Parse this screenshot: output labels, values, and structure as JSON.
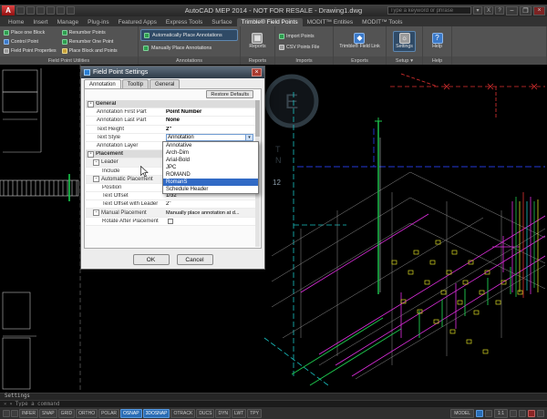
{
  "window": {
    "title": "AutoCAD MEP 2014 - NOT FOR RESALE - Drawing1.dwg",
    "search_placeholder": "Type a keyword or phrase",
    "logo_letter": "A",
    "controls": {
      "min": "–",
      "max": "❐",
      "close": "×"
    }
  },
  "ribbon": {
    "tabs": [
      "Home",
      "Insert",
      "Manage",
      "Plug-ins",
      "Featured Apps",
      "Express Tools",
      "Surface",
      "Trimble® Field Points",
      "MODIT™ Entities",
      "MODIT™ Tools"
    ],
    "panels": [
      {
        "label": "Field Point Utilities",
        "items": [
          "Place one Block",
          "Control Point",
          "Field Point Properties",
          "Renumber Points",
          "Renumber One Point",
          "Place Block and Points"
        ]
      },
      {
        "label": "Annotations",
        "items": [
          "Automatically Place Annotations",
          "Manually Place Annotations"
        ]
      },
      {
        "label": "Reports",
        "items": [
          "Reports"
        ]
      },
      {
        "label": "Imports",
        "items": [
          "Import Points",
          "CSV Points File"
        ]
      },
      {
        "label": "Exports",
        "items": [
          "Trimble® Field Link"
        ]
      },
      {
        "label": "Setup",
        "items": [
          "Settings"
        ]
      },
      {
        "label": "Help",
        "items": [
          "Help"
        ]
      }
    ]
  },
  "dialog": {
    "title": "Field Point Settings",
    "tabs": [
      "Annotation",
      "Tooltip",
      "General"
    ],
    "restore_label": "Restore Defaults",
    "rows": [
      {
        "label": "General",
        "value": ""
      },
      {
        "label": "Annotation First Part",
        "value": "Point Number"
      },
      {
        "label": "Annotation Last Part",
        "value": "None"
      },
      {
        "label": "Text Height",
        "value": "2\""
      },
      {
        "label": "Text Style",
        "value": "Annotation"
      },
      {
        "label": "Annotation Layer",
        "value": ""
      },
      {
        "label": "Placement",
        "value": ""
      },
      {
        "label": "Leader",
        "value": ""
      },
      {
        "label": "Include",
        "value": ""
      },
      {
        "label": "Automatic Placement",
        "value": ""
      },
      {
        "label": "Position",
        "value": ""
      },
      {
        "label": "Text Offset",
        "value": "1/32\""
      },
      {
        "label": "Text Offset with Leader",
        "value": "2\""
      },
      {
        "label": "Manual Placement",
        "value": "Manually place annotation at d..."
      },
      {
        "label": "Rotate After Placement",
        "value": ""
      }
    ],
    "dropdown_options": [
      "Annotative",
      "Arch-Dim",
      "Arial-Bold",
      "JPC",
      "ROMAND",
      "RomanS",
      "Schedule Header"
    ],
    "ok_label": "OK",
    "cancel_label": "Cancel"
  },
  "drawing": {
    "watermark_letter": "E",
    "watermark_vertical": [
      "T",
      "N"
    ],
    "watermark_number": "12"
  },
  "command": {
    "history": "Settings",
    "placeholder": "Type a command"
  },
  "statusbar": {
    "toggles": [
      "INFER",
      "SNAP",
      "GRID",
      "ORTHO",
      "POLAR",
      "OSNAP",
      "3DOSNAP",
      "OTRACK",
      "DUCS",
      "DYN",
      "LWT",
      "TPY"
    ],
    "model_label": "MODEL",
    "scale_label": "1:1"
  }
}
